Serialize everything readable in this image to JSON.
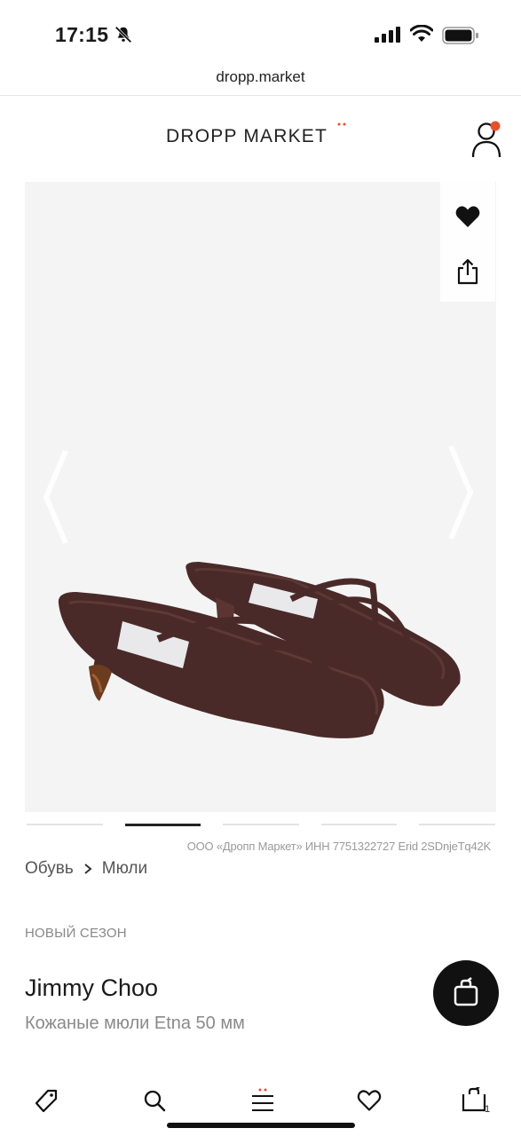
{
  "status_bar": {
    "time": "17:15",
    "icons": [
      "bell-slash-icon",
      "signal-icon",
      "wifi-icon",
      "battery-icon"
    ]
  },
  "browser": {
    "url": "dropp.market"
  },
  "header": {
    "logo": "DROPP MARKET",
    "accent_color": "#e8502b",
    "profile_icon": "user-icon"
  },
  "product_image": {
    "icons": [
      "heart-icon",
      "share-icon",
      "chevron-left-icon",
      "chevron-right-icon"
    ],
    "carousel_total": 5,
    "carousel_active": 2
  },
  "legal": "ООО «Дропп Маркет» ИНН 7751322727 Erid 2SDnjeTq42K",
  "breadcrumb": {
    "items": [
      "Обувь",
      "Мюли"
    ]
  },
  "product": {
    "season": "НОВЫЙ СЕЗОН",
    "brand": "Jimmy Choo",
    "name": "Кожаные мюли Etna 50 мм"
  },
  "bottom_nav": {
    "items": [
      "tag-icon",
      "search-icon",
      "menu-icon",
      "heart-icon",
      "cart-icon"
    ],
    "cart_count": "1"
  },
  "colors": {
    "shoe": "#4a2a28",
    "fab": "#111111"
  }
}
